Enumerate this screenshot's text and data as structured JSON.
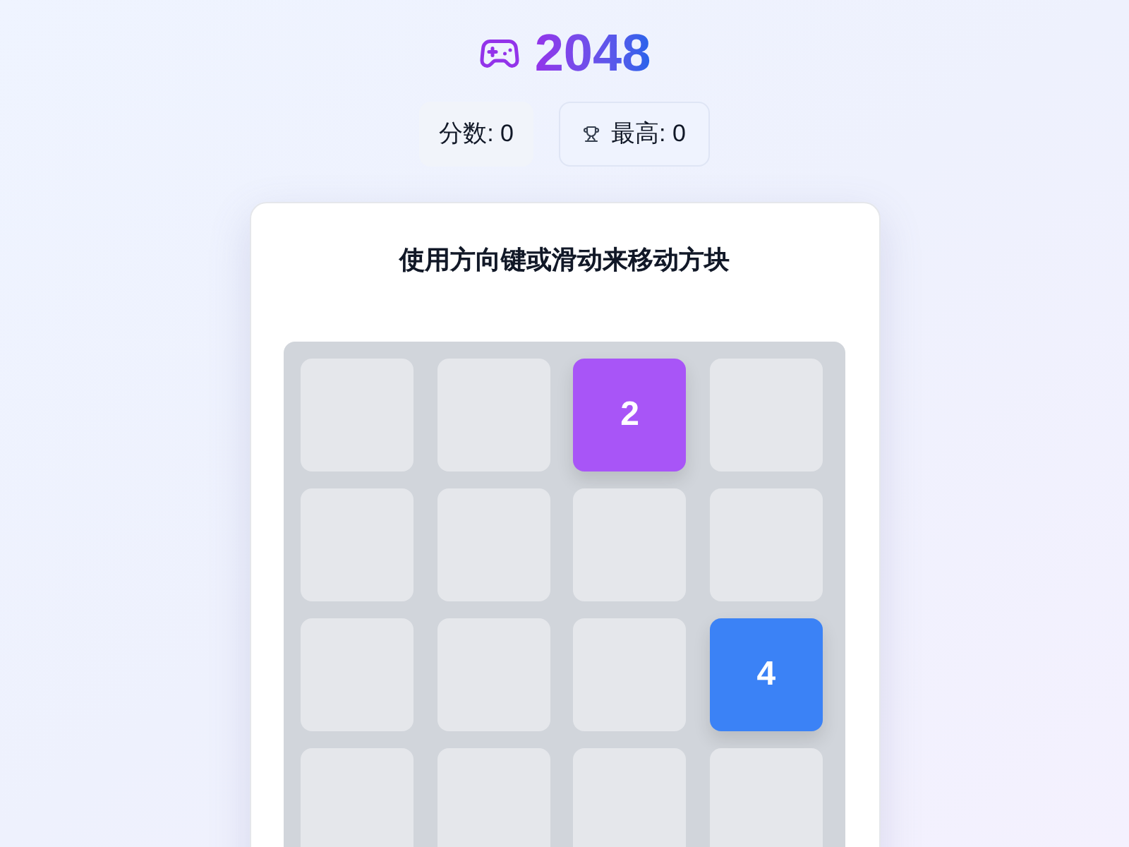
{
  "header": {
    "title": "2048"
  },
  "scores": [
    {
      "kind": "score",
      "label": "分数: 0"
    },
    {
      "kind": "best",
      "label": "最高: 0"
    }
  ],
  "card": {
    "instruction": "使用方向键或滑动来移动方块"
  },
  "board": {
    "rows": [
      [
        {
          "kind": "empty"
        },
        {
          "kind": "empty"
        },
        {
          "kind": "tile",
          "value": "2",
          "color": "#a855f7"
        },
        {
          "kind": "empty"
        }
      ],
      [
        {
          "kind": "empty"
        },
        {
          "kind": "empty"
        },
        {
          "kind": "empty"
        },
        {
          "kind": "empty"
        }
      ],
      [
        {
          "kind": "empty"
        },
        {
          "kind": "empty"
        },
        {
          "kind": "empty"
        },
        {
          "kind": "tile",
          "value": "4",
          "color": "#3b82f6"
        }
      ],
      [
        {
          "kind": "empty"
        },
        {
          "kind": "empty"
        },
        {
          "kind": "empty"
        },
        {
          "kind": "empty"
        }
      ]
    ]
  }
}
